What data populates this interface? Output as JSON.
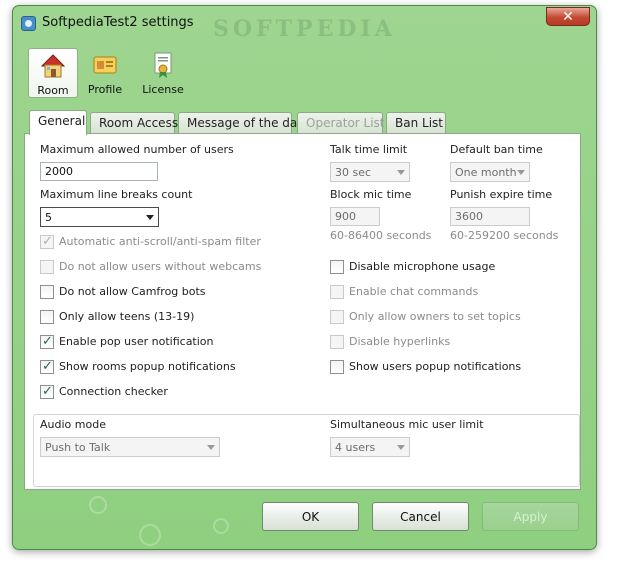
{
  "window": {
    "title": "SoftpediaTest2 settings",
    "close_glyph": "✕",
    "watermark": "SOFTPEDIA"
  },
  "icon_tabs": [
    {
      "label": "Room",
      "icon": "house-icon",
      "active": true
    },
    {
      "label": "Profile",
      "icon": "profile-card-icon",
      "active": false
    },
    {
      "label": "License",
      "icon": "license-certificate-icon",
      "active": false
    }
  ],
  "tabs": [
    {
      "label": "General",
      "active": true
    },
    {
      "label": "Room Access"
    },
    {
      "label": "Message of the day"
    },
    {
      "label": "Operator List",
      "disabled": true
    },
    {
      "label": "Ban List"
    }
  ],
  "general": {
    "max_users_label": "Maximum allowed number of users",
    "max_users_value": "2000",
    "max_line_breaks_label": "Maximum line breaks count",
    "max_line_breaks_value": "5",
    "talk_time_label": "Talk time limit",
    "talk_time_value": "30 sec",
    "default_ban_label": "Default ban time",
    "default_ban_value": "One month",
    "block_mic_label": "Block mic time",
    "block_mic_value": "900",
    "block_mic_range": "60-86400 seconds",
    "punish_label": "Punish expire time",
    "punish_value": "3600",
    "punish_range": "60-259200 seconds",
    "left_checks": [
      {
        "label": "Automatic anti-scroll/anti-spam filter",
        "checked": true,
        "disabled": true
      },
      {
        "label": "Do not allow users without webcams",
        "checked": false,
        "disabled": true
      },
      {
        "label": "Do not allow Camfrog bots",
        "checked": false,
        "disabled": false
      },
      {
        "label": "Only allow teens (13-19)",
        "checked": false,
        "disabled": false
      },
      {
        "label": "Enable pop user notification",
        "checked": true,
        "disabled": false
      },
      {
        "label": "Show rooms popup notifications",
        "checked": true,
        "disabled": false
      },
      {
        "label": "Connection checker",
        "checked": true,
        "disabled": false
      }
    ],
    "right_checks": [
      {
        "label": "Disable microphone usage",
        "checked": false,
        "disabled": false
      },
      {
        "label": "Enable chat commands",
        "checked": false,
        "disabled": true
      },
      {
        "label": "Only allow owners to set topics",
        "checked": false,
        "disabled": true
      },
      {
        "label": "Disable hyperlinks",
        "checked": false,
        "disabled": true
      },
      {
        "label": "Show users popup notifications",
        "checked": false,
        "disabled": false
      }
    ],
    "audio_mode_label": "Audio mode",
    "audio_mode_value": "Push to Talk",
    "mic_limit_label": "Simultaneous mic user limit",
    "mic_limit_value": "4 users"
  },
  "buttons": {
    "ok": "OK",
    "cancel": "Cancel",
    "apply": "Apply"
  },
  "colors": {
    "window_bg": "#9ed590",
    "check_color": "#27683b"
  }
}
